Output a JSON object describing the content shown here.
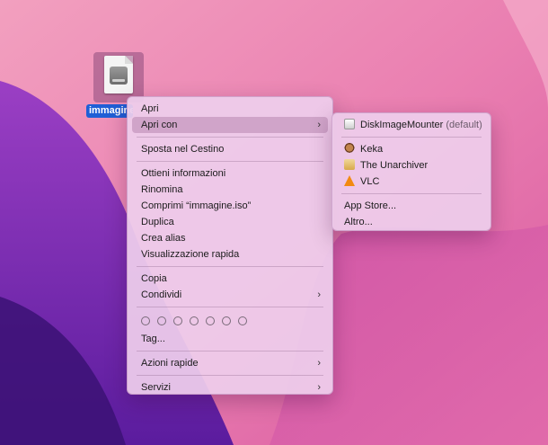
{
  "desktop": {
    "file_label": "immagine.iso",
    "file_icon": "disk-image-icon"
  },
  "context_menu": {
    "items": [
      {
        "label": "Apri"
      },
      {
        "label": "Apri con",
        "has_submenu": true,
        "highlighted": true
      },
      {
        "label": "Sposta nel Cestino"
      },
      {
        "label": "Ottieni informazioni"
      },
      {
        "label": "Rinomina"
      },
      {
        "label": "Comprimi “immagine.iso”"
      },
      {
        "label": "Duplica"
      },
      {
        "label": "Crea alias"
      },
      {
        "label": "Visualizzazione rapida"
      },
      {
        "label": "Copia"
      },
      {
        "label": "Condividi",
        "has_submenu": true
      },
      {
        "label": "Tag..."
      },
      {
        "label": "Azioni rapide",
        "has_submenu": true
      },
      {
        "label": "Servizi",
        "has_submenu": true
      }
    ],
    "tag_count": 7,
    "chevron": "›"
  },
  "open_with_submenu": {
    "default_app": {
      "label": "DiskImageMounter",
      "suffix": "(default)",
      "icon": "disk-image-mounter-icon"
    },
    "apps": [
      {
        "label": "Keka",
        "icon": "keka-icon"
      },
      {
        "label": "The Unarchiver",
        "icon": "unarchiver-icon"
      },
      {
        "label": "VLC",
        "icon": "vlc-icon"
      }
    ],
    "extras": [
      {
        "label": "App Store..."
      },
      {
        "label": "Altro..."
      }
    ]
  },
  "colors": {
    "highlight": "#aa78a5",
    "selection": "#1f5fd6"
  }
}
